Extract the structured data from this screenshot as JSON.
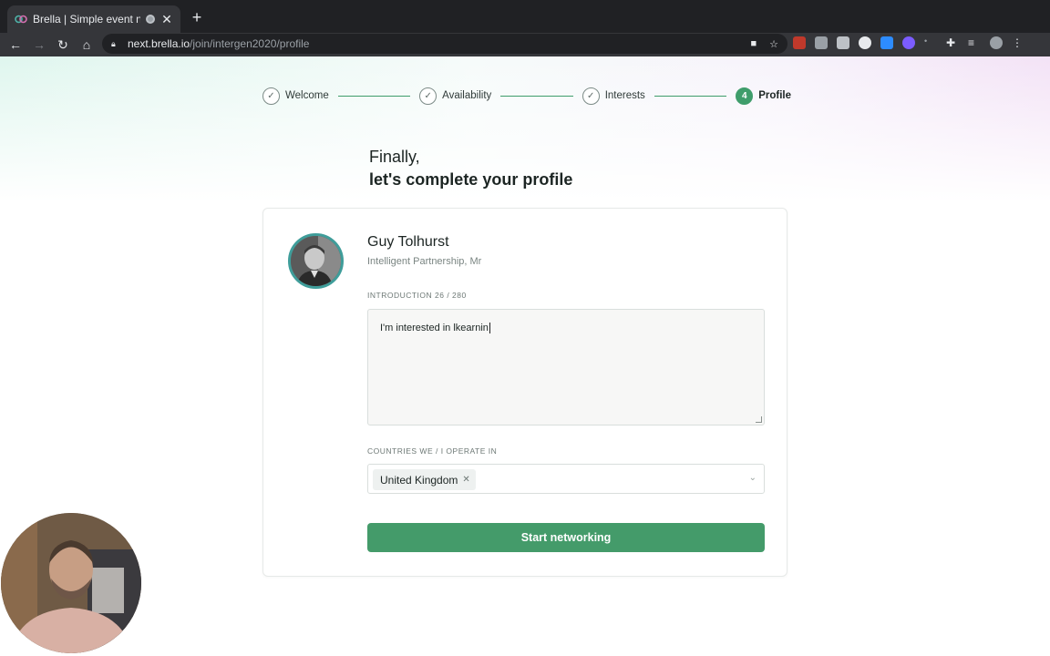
{
  "browser": {
    "tab_title": "Brella | Simple event netwo",
    "new_tab": "+",
    "url_host": "next.brella.io",
    "url_path": "/join/intergen2020/profile"
  },
  "stepper": {
    "steps": [
      {
        "label": "Welcome",
        "state": "done"
      },
      {
        "label": "Availability",
        "state": "done"
      },
      {
        "label": "Interests",
        "state": "done"
      },
      {
        "label": "Profile",
        "state": "active",
        "number": "4"
      }
    ]
  },
  "heading": {
    "line1": "Finally,",
    "line2": "let's complete your profile"
  },
  "profile": {
    "name": "Guy Tolhurst",
    "organization": "Intelligent Partnership, Mr"
  },
  "introduction": {
    "label": "INTRODUCTION 26 / 280",
    "value": "I'm interested in lkearnin"
  },
  "countries": {
    "label": "COUNTRIES WE / I OPERATE IN",
    "selected": "United Kingdom"
  },
  "actions": {
    "submit_label": "Start networking"
  },
  "colors": {
    "accent": "#449b6a",
    "avatar_ring": "#3f9d9a"
  }
}
